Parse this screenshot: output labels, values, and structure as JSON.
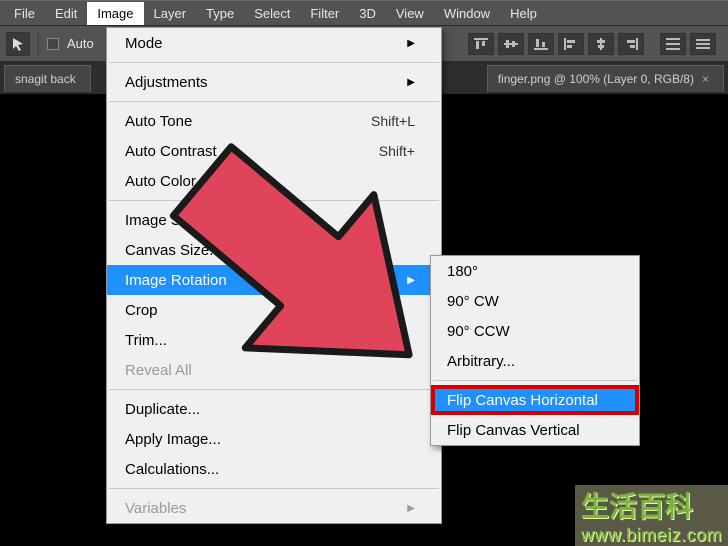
{
  "menubar": [
    "File",
    "Edit",
    "Image",
    "Layer",
    "Type",
    "Select",
    "Filter",
    "3D",
    "View",
    "Window",
    "Help"
  ],
  "activeMenuIndex": 2,
  "options": {
    "auto_label": "Auto"
  },
  "tabs": [
    {
      "label": "snagit back"
    },
    {
      "label": "finger.png @ 100% (Layer 0, RGB/8)"
    }
  ],
  "imageMenu": {
    "mode": "Mode",
    "adjustments": "Adjustments",
    "autoTone": {
      "label": "Auto Tone",
      "shortcut": "Shift+L"
    },
    "autoContrast": {
      "label": "Auto Contrast",
      "shortcut": "Shift+"
    },
    "autoColor": "Auto Color",
    "imageSize": "Image Size...",
    "canvasSize": "Canvas Size...",
    "imageRotation": "Image Rotation",
    "crop": "Crop",
    "trim": "Trim...",
    "revealAll": "Reveal All",
    "duplicate": "Duplicate...",
    "applyImage": "Apply Image...",
    "calculations": "Calculations...",
    "variables": "Variables"
  },
  "rotationSubmenu": {
    "r180": "180°",
    "r90cw": "90° CW",
    "r90ccw": "90° CCW",
    "arbitrary": "Arbitrary...",
    "flipH": "Flip Canvas Horizontal",
    "flipV": "Flip Canvas Vertical"
  },
  "watermark": {
    "line1": "生活百科",
    "line2": "www.bimeiz.com"
  }
}
